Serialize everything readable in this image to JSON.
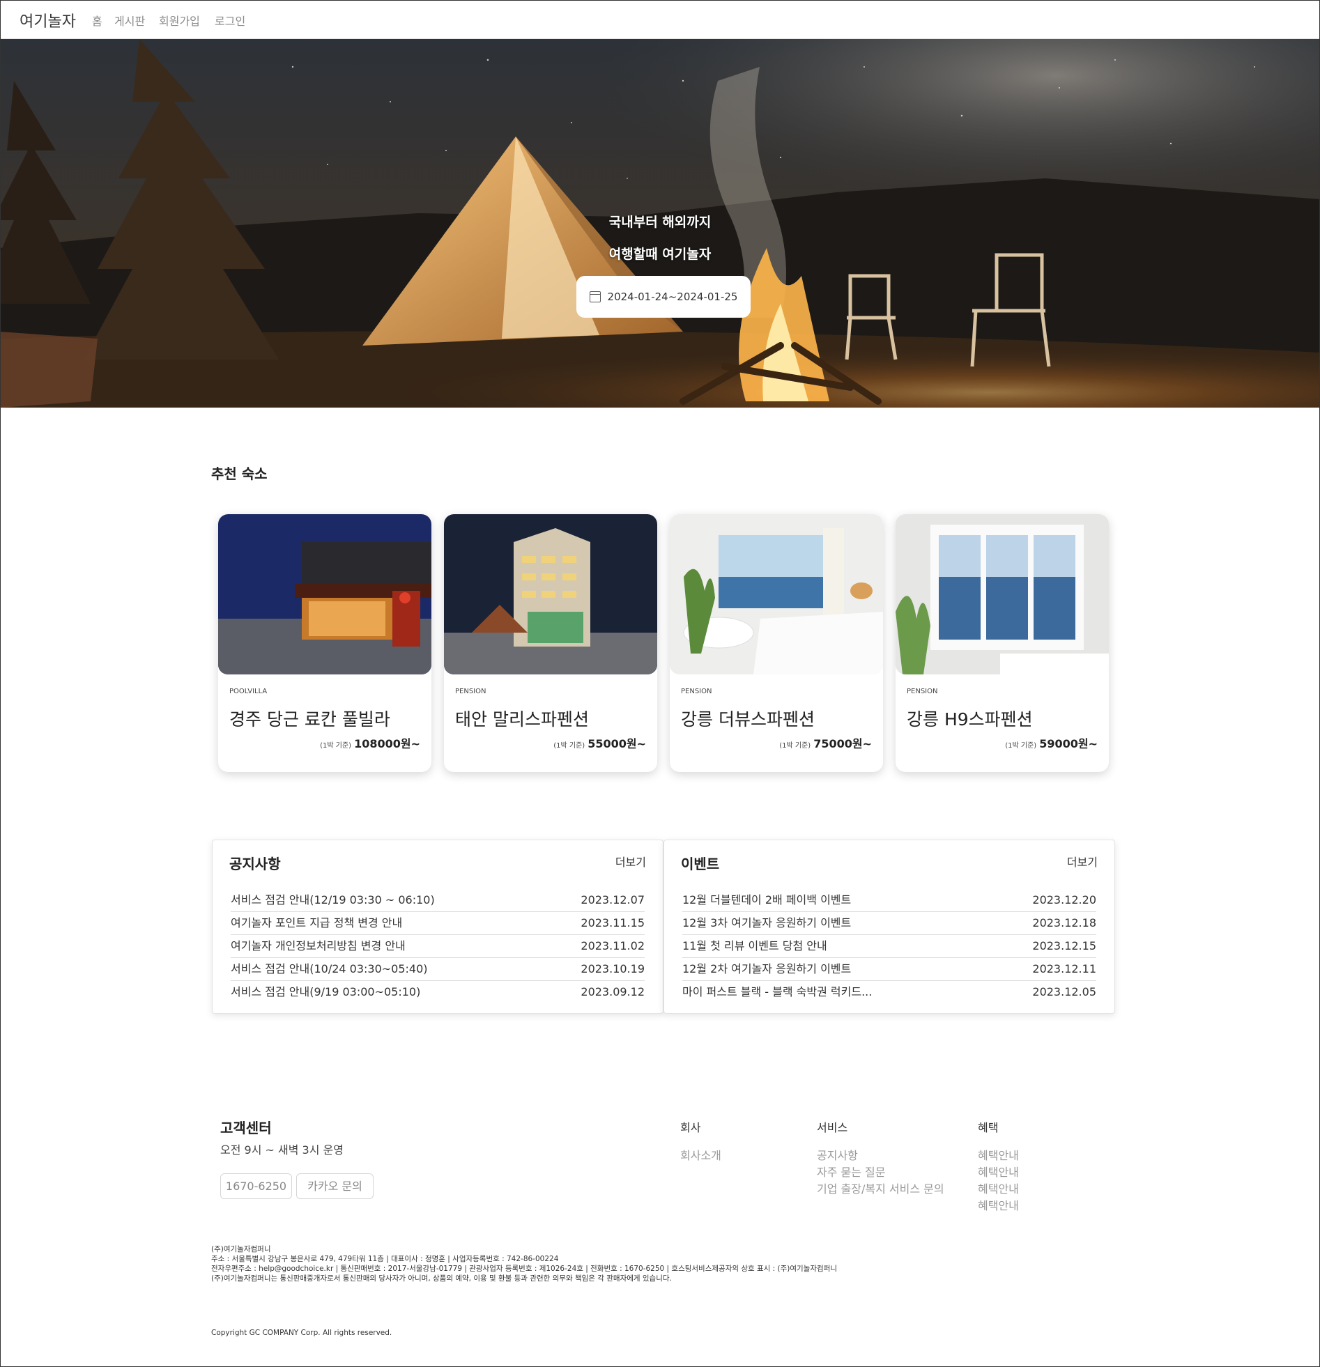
{
  "navbar": {
    "brand": "여기놀자",
    "links": [
      "홈",
      "게시판",
      "회원가입",
      "로그인"
    ]
  },
  "hero": {
    "line1": "국내부터 해외까지",
    "line2": "여행할때 여기놀자",
    "date_range": "2024-01-24~2024-01-25",
    "calendar_icon": "calendar-icon"
  },
  "recommended": {
    "title": "추천 숙소",
    "price_note": "(1박 기준)",
    "items": [
      {
        "type": "POOLVILLA",
        "name": "경주 당근 료칸 풀빌라",
        "price": "108000원~"
      },
      {
        "type": "PENSION",
        "name": "태안 말리스파펜션",
        "price": "55000원~"
      },
      {
        "type": "PENSION",
        "name": "강릉 더뷰스파펜션",
        "price": "75000원~"
      },
      {
        "type": "PENSION",
        "name": "강릉 H9스파펜션",
        "price": "59000원~"
      }
    ]
  },
  "notices": {
    "title": "공지사항",
    "more": "더보기",
    "rows": [
      {
        "title": "서비스 점검 안내(12/19 03:30 ~ 06:10)",
        "date": "2023.12.07"
      },
      {
        "title": "여기놀자 포인트 지급 정책 변경 안내",
        "date": "2023.11.15"
      },
      {
        "title": "여기놀자 개인정보처리방침 변경 안내",
        "date": "2023.11.02"
      },
      {
        "title": "서비스 점검 안내(10/24 03:30~05:40)",
        "date": "2023.10.19"
      },
      {
        "title": "서비스 점검 안내(9/19 03:00~05:10)",
        "date": "2023.09.12"
      }
    ]
  },
  "events": {
    "title": "이벤트",
    "more": "더보기",
    "rows": [
      {
        "title": "12월 더블텐데이 2배 페이백 이벤트",
        "date": "2023.12.20"
      },
      {
        "title": "12월 3차 여기놀자 응원하기 이벤트",
        "date": "2023.12.18"
      },
      {
        "title": "11월 첫 리뷰 이벤트 당첨 안내",
        "date": "2023.12.15"
      },
      {
        "title": "12월 2차 여기놀자 응원하기 이벤트",
        "date": "2023.12.11"
      },
      {
        "title": "마이 퍼스트 블랙 - 블랙 숙박권 럭키드...",
        "date": "2023.12.05"
      }
    ]
  },
  "footer": {
    "cs_title": "고객센터",
    "cs_hours": "오전 9시 ~ 새벽 3시 운영",
    "phone_button": "1670-6250",
    "kakao_button": "카카오 문의",
    "company": {
      "head": "회사",
      "links": [
        "회사소개"
      ]
    },
    "service": {
      "head": "서비스",
      "links": [
        "공지사항",
        "자주 묻는 질문",
        "기업 출장/복지 서비스 문의"
      ]
    },
    "benefit": {
      "head": "혜택",
      "links": [
        "혜택안내",
        "혜택안내",
        "혜택안내",
        "혜택안내"
      ]
    },
    "legal": [
      "(주)여기놀자컴퍼니",
      "주소 : 서울특별시 강남구 봉은사로 479, 479타워 11층 | 대표이사 : 정명훈 | 사업자등록번호 : 742-86-00224",
      "전자우편주소 : help@goodchoice.kr | 통신판매번호 : 2017-서울강남-01779 | 관광사업자 등록번호 : 제1026-24호 | 전화번호 : 1670-6250 | 호스팅서비스제공자의 상호 표시 : (주)여기놀자컴퍼니",
      "(주)여기놀자컴퍼니는 통신판매중개자로서 통신판매의 당사자가 아니며, 상품의 예약, 이용 및 환불 등과 관련한 의무와 책임은 각 판매자에게 있습니다."
    ],
    "copyright": "Copyright GC COMPANY Corp. All rights reserved."
  }
}
